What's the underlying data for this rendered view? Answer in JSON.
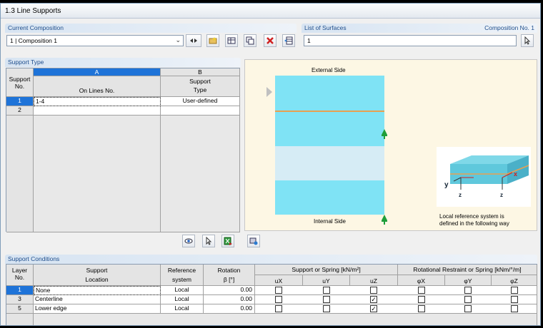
{
  "title": "1.3 Line Supports",
  "current_composition": {
    "header": "Current Composition",
    "value": "1 | Composition 1"
  },
  "list_of_surfaces": {
    "header": "List of Surfaces",
    "composition_label": "Composition No. 1",
    "value": "1"
  },
  "support_type": {
    "header": "Support Type",
    "col_a_letter": "A",
    "col_b_letter": "B",
    "row_header": [
      "Support",
      "No."
    ],
    "col_a_label": "On Lines No.",
    "col_b_label": [
      "Support",
      "Type"
    ],
    "rows": [
      {
        "no": "1",
        "lines": "1-4",
        "type": "User-defined"
      },
      {
        "no": "2",
        "lines": "",
        "type": ""
      }
    ]
  },
  "diagram": {
    "external_side": "External Side",
    "internal_side": "Internal Side",
    "note_line1": "Local reference system is",
    "note_line2": "defined in the following way",
    "axis_y": "y",
    "axis_z": "z",
    "axis_x": "x"
  },
  "support_conditions": {
    "header": "Support Conditions",
    "headers": {
      "layer": [
        "Layer",
        "No."
      ],
      "location": [
        "Support",
        "Location"
      ],
      "refsys": [
        "Reference",
        "system"
      ],
      "rotation": [
        "Rotation",
        "β [°]"
      ],
      "spring_group": "Support or Spring [kN/m²]",
      "rot_group": "Rotational Restraint or Spring [kNm/°/m]",
      "ux": "uX",
      "uy": "uY",
      "uz": "uZ",
      "px": "φX",
      "py": "φY",
      "pz": "φZ"
    },
    "rows": [
      {
        "layer": "1",
        "location": "None",
        "refsys": "Local",
        "rotation": "0.00",
        "ux": false,
        "uy": false,
        "uz": false,
        "px": false,
        "py": false,
        "pz": false
      },
      {
        "layer": "3",
        "location": "Centerline",
        "refsys": "Local",
        "rotation": "0.00",
        "ux": false,
        "uy": false,
        "uz": true,
        "px": false,
        "py": false,
        "pz": false
      },
      {
        "layer": "5",
        "location": "Lower edge",
        "refsys": "Local",
        "rotation": "0.00",
        "ux": false,
        "uy": false,
        "uz": true,
        "px": false,
        "py": false,
        "pz": false
      }
    ]
  },
  "colors": {
    "accent": "#1e73d8",
    "layer_cyan": "#7fe3f5",
    "layer_pale": "#d6ecf5",
    "interface": "#e8a050",
    "support_green": "#1e9e3a"
  }
}
